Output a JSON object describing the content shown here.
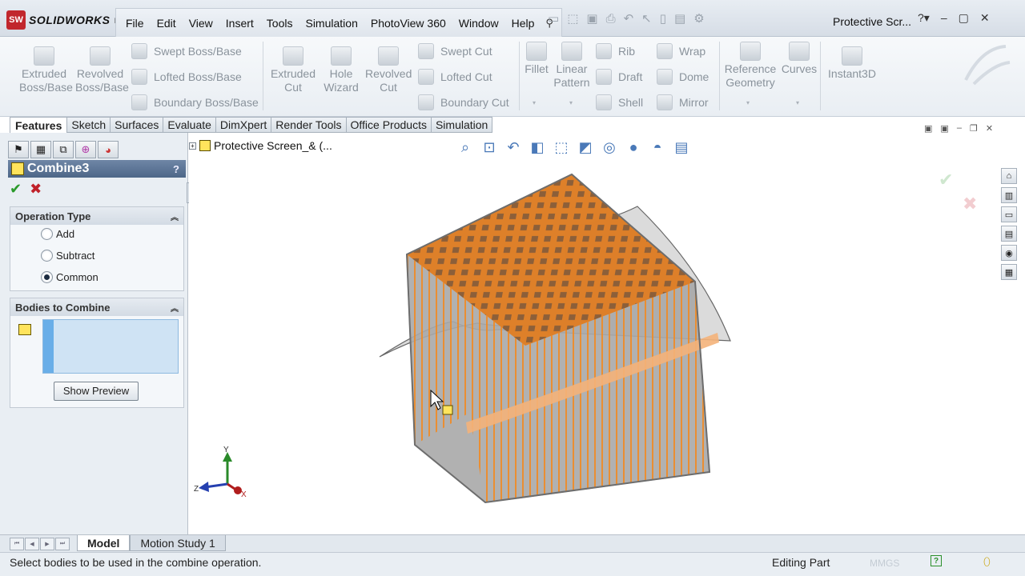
{
  "app": {
    "logo_text": "SOLIDWORKS",
    "logo_mark": "SW",
    "document_title": "Protective Scr..."
  },
  "menu": {
    "items": [
      "File",
      "Edit",
      "View",
      "Insert",
      "Tools",
      "Simulation",
      "PhotoView 360",
      "Window",
      "Help"
    ]
  },
  "ribbon": {
    "extruded_boss": "Extruded\nBoss/Base",
    "revolved_boss": "Revolved\nBoss/Base",
    "swept_boss": "Swept Boss/Base",
    "lofted_boss": "Lofted Boss/Base",
    "boundary_boss": "Boundary Boss/Base",
    "extruded_cut": "Extruded\nCut",
    "hole_wizard": "Hole\nWizard",
    "revolved_cut": "Revolved\nCut",
    "swept_cut": "Swept Cut",
    "lofted_cut": "Lofted Cut",
    "boundary_cut": "Boundary Cut",
    "fillet": "Fillet",
    "linear_pattern": "Linear\nPattern",
    "rib": "Rib",
    "draft": "Draft",
    "shell": "Shell",
    "wrap": "Wrap",
    "dome": "Dome",
    "mirror": "Mirror",
    "reference_geometry": "Reference\nGeometry",
    "curves": "Curves",
    "instant3d": "Instant3D"
  },
  "command_tabs": [
    "Features",
    "Sketch",
    "Surfaces",
    "Evaluate",
    "DimXpert",
    "Render Tools",
    "Office Products",
    "Simulation"
  ],
  "property_manager": {
    "title": "Combine3",
    "help": "?",
    "operation_type": {
      "title": "Operation Type",
      "options": [
        "Add",
        "Subtract",
        "Common"
      ],
      "selected": "Common"
    },
    "bodies": {
      "title": "Bodies to Combine",
      "preview_button": "Show Preview"
    }
  },
  "feature_tree": {
    "label": "Protective Screen_&  (..."
  },
  "triad": {
    "x": "X",
    "y": "Y",
    "z": "Z"
  },
  "bottom_tabs": [
    "Model",
    "Motion Study 1"
  ],
  "status": {
    "message": "Select bodies to be used in the combine operation.",
    "mode": "Editing Part",
    "units": "MMGS"
  },
  "colors": {
    "accent": "#f08a24",
    "header_blue": "#5a7396",
    "ok_green": "#2a9a2a",
    "cancel_red": "#c0212a"
  },
  "icons": [
    "features-manager-icon",
    "property-manager-icon",
    "config-manager-icon",
    "dimxpert-icon",
    "display-manager-icon"
  ]
}
